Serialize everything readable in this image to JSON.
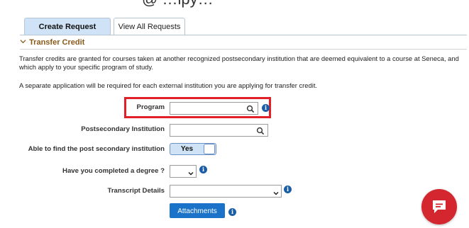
{
  "top_partial_text": "@ …ipy…",
  "tabs": [
    {
      "label": "Create Request",
      "active": true
    },
    {
      "label": "View All Requests",
      "active": false
    }
  ],
  "section": {
    "title": "Transfer Credit",
    "paragraph1": "Transfer credits are granted for courses taken at another recognized postsecondary institution that are deemed equivalent to a course at Seneca, and which apply to your specific program of study.",
    "paragraph2": "A separate application will be required for each external institution you are applying for transfer credit."
  },
  "form": {
    "program": {
      "label": "Program",
      "value": ""
    },
    "institution": {
      "label": "Postsecondary Institution",
      "value": ""
    },
    "find_institution": {
      "label": "Able to find the post secondary institution",
      "toggle_label": "Yes",
      "on": true
    },
    "degree": {
      "label": "Have you completed a degree ?",
      "value": ""
    },
    "transcript": {
      "label": "Transcript Details",
      "value": ""
    },
    "attachments_label": "Attachments"
  },
  "info_glyph": "i",
  "colors": {
    "accent": "#1a73c9",
    "tab_active_bg": "#cfe2f6",
    "section_title": "#8a5a1a",
    "highlight": "#e2202a",
    "chat": "#d3262e",
    "info": "#1b5ea8"
  },
  "icons": [
    "search-icon",
    "info-icon",
    "chevron-down-icon",
    "chat-icon"
  ]
}
